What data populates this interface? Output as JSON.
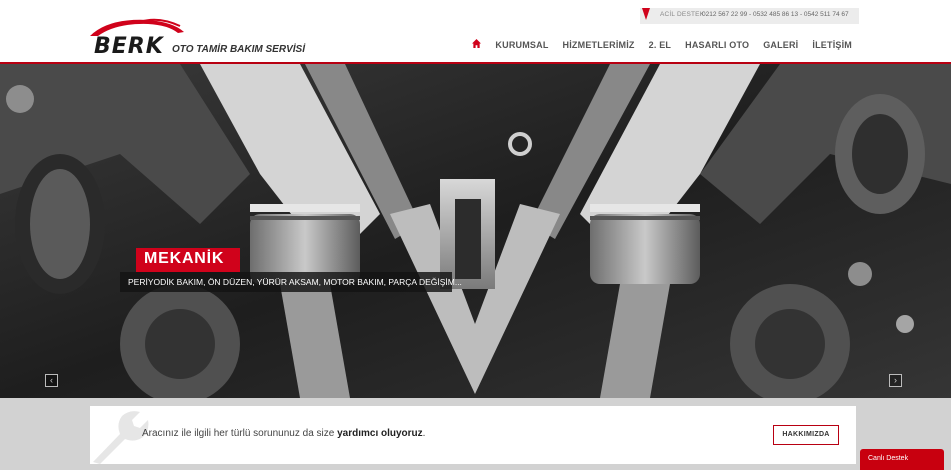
{
  "brand": {
    "name": "BERK",
    "tagline": "OTO TAMİR BAKIM SERVİSİ"
  },
  "topbar": {
    "label": "ACİL DESTEK",
    "phones": "0212 567 22 99 - 0532 485 86 13 - 0542 511 74 67"
  },
  "nav": {
    "home_icon": "home-icon",
    "items": [
      "KURUMSAL",
      "HİZMETLERİMİZ",
      "2. EL",
      "HASARLI OTO",
      "GALERİ",
      "İLETİŞİM"
    ]
  },
  "slider": {
    "title": "MEKANİK",
    "text": "PERİYODİK BAKIM, ÖN DÜZEN, YÜRÜR AKSAM, MOTOR BAKIM, PARÇA DEĞİŞİM...",
    "prev_icon": "chevron-left-icon",
    "next_icon": "chevron-right-icon"
  },
  "banner": {
    "text_before": "Aracınız ile ilgili her türlü sorununuz da size ",
    "text_bold": "yardımcı oluyoruz",
    "text_after": ".",
    "button_label": "HAKKIMIZDA",
    "icon": "wrench-icon"
  },
  "live_support": {
    "label": "Canlı Destek"
  },
  "colors": {
    "accent": "#d0021b",
    "accent_dark": "#b80012",
    "band": "#d2d2d2"
  }
}
